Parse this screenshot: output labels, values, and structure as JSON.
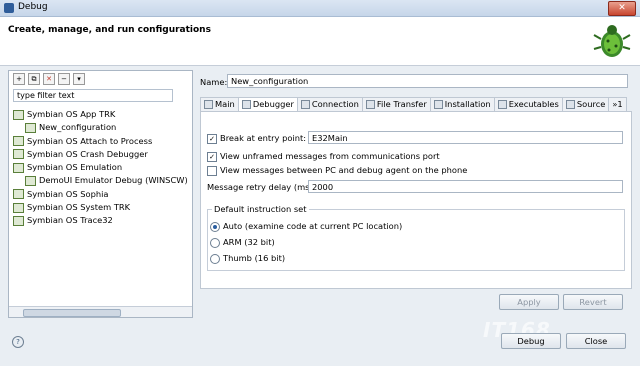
{
  "window": {
    "title": "Debug",
    "close_label": "✕"
  },
  "header": {
    "title": "Create, manage, and run configurations"
  },
  "left": {
    "filter_placeholder": "type filter text",
    "tree": [
      {
        "label": "Symbian OS App TRK",
        "level": 0
      },
      {
        "label": "New_configuration",
        "level": 1
      },
      {
        "label": "Symbian OS Attach to Process",
        "level": 0
      },
      {
        "label": "Symbian OS Crash Debugger",
        "level": 0
      },
      {
        "label": "Symbian OS Emulation",
        "level": 0
      },
      {
        "label": "DemoUI Emulator Debug (WINSCW)",
        "level": 1
      },
      {
        "label": "Symbian OS Sophia",
        "level": 0
      },
      {
        "label": "Symbian OS System TRK",
        "level": 0
      },
      {
        "label": "Symbian OS Trace32",
        "level": 0
      }
    ]
  },
  "right": {
    "name_label": "Name:",
    "name_value": "New_configuration",
    "tabs": [
      "Main",
      "Debugger",
      "Connection",
      "File Transfer",
      "Installation",
      "Executables",
      "Source",
      "»1"
    ],
    "active_tab": "Debugger",
    "debugger": {
      "break_label": "Break at entry point:",
      "break_checked": true,
      "break_value": "E32Main",
      "unframed_label": "View unframed messages from communications port",
      "unframed_checked": true,
      "view_messages_label": "View messages between PC and debug agent on the phone",
      "view_messages_checked": false,
      "retry_label": "Message retry delay (ms):",
      "retry_value": "2000",
      "instruction_set_label": "Default instruction set",
      "options": [
        {
          "label": "Auto (examine code at current PC location)",
          "selected": true
        },
        {
          "label": "ARM (32 bit)",
          "selected": false
        },
        {
          "label": "Thumb (16 bit)",
          "selected": false
        }
      ]
    },
    "apply_label": "Apply",
    "revert_label": "Revert"
  },
  "footer": {
    "help_label": "?",
    "debug_label": "Debug",
    "close_label": "Close"
  },
  "watermark": "IT168"
}
